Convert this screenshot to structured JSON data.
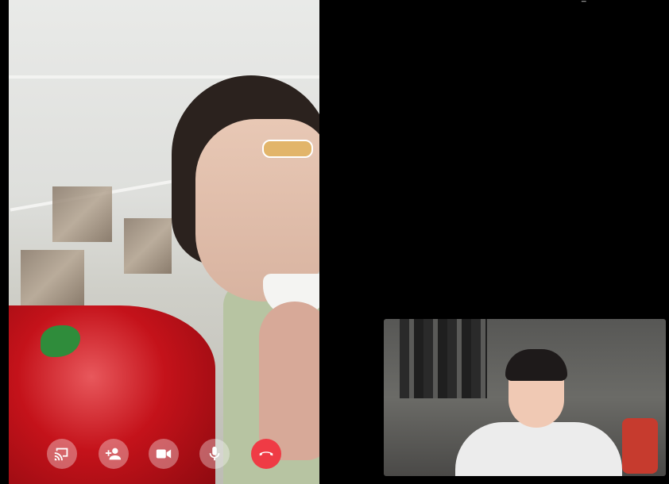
{
  "call": {
    "controls": [
      {
        "name": "screen-share-button",
        "icon": "cast-icon"
      },
      {
        "name": "add-person-button",
        "icon": "add-person-icon"
      },
      {
        "name": "camera-button",
        "icon": "video-camera-icon"
      },
      {
        "name": "microphone-button",
        "icon": "microphone-icon"
      },
      {
        "name": "end-call-button",
        "icon": "phone-hangup-icon",
        "color": "#ef3b45"
      }
    ],
    "expand_glyph": "⟩"
  }
}
